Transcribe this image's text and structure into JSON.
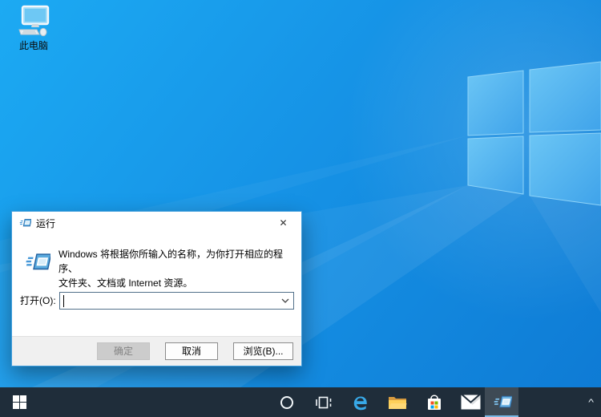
{
  "desktop": {
    "this_pc_label": "此电脑"
  },
  "dialog": {
    "title": "运行",
    "close_glyph": "✕",
    "description_line1": "Windows 将根据你所输入的名称，为你打开相应的程序、",
    "description_line2": "文件夹、文档或 Internet 资源。",
    "open_label": "打开(O):",
    "input_value": "",
    "buttons": {
      "ok": {
        "label": "确定",
        "enabled": false
      },
      "cancel": {
        "label": "取消",
        "enabled": true
      },
      "browse": {
        "label": "浏览(B)...",
        "enabled": true
      }
    }
  },
  "taskbar": {
    "items": [
      {
        "name": "start",
        "icon": "windows-logo-icon"
      },
      {
        "name": "cortana",
        "icon": "cortana-circle-icon"
      },
      {
        "name": "task-view",
        "icon": "task-view-icon"
      },
      {
        "name": "edge",
        "icon": "edge-e-icon"
      },
      {
        "name": "file-explorer",
        "icon": "folder-icon"
      },
      {
        "name": "store",
        "icon": "store-bag-icon"
      },
      {
        "name": "mail",
        "icon": "envelope-icon"
      },
      {
        "name": "run-app",
        "icon": "run-window-icon",
        "active": true
      }
    ],
    "tray_expand_glyph": "^"
  },
  "colors": {
    "wallpaper_top": "#1caaf3",
    "wallpaper_mid": "#1693e6",
    "wallpaper_bottom": "#0e7ad4",
    "logo_pane": "#4db3f0",
    "taskbar_bg": "#1f2d3a",
    "active_underline": "#7cb8e4",
    "dialog_border": "#3f9ddc",
    "footer_bg": "#f0f0f0",
    "disabled_text": "#838383",
    "store_red": "#f25022",
    "store_green": "#7fba00",
    "store_blue": "#00a4ef",
    "store_yellow": "#ffb900"
  }
}
